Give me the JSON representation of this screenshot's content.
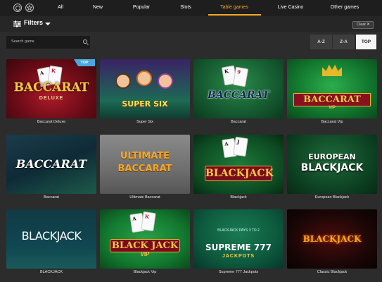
{
  "nav": {
    "tabs": [
      "All",
      "New",
      "Popular",
      "Slots",
      "Table games",
      "Live Casino",
      "Other games"
    ],
    "active_tab": "Table games",
    "icons": [
      "chip-icon",
      "star-icon"
    ]
  },
  "filters": {
    "label": "Filters",
    "clear_label": "Clear",
    "clear_icon": "✕"
  },
  "search": {
    "placeholder": "Search game"
  },
  "sort": {
    "options": [
      "A-Z",
      "Z-A",
      "TOP"
    ],
    "active": "TOP"
  },
  "badge_top": "TOP",
  "games": [
    {
      "name": "Baccarat Deluxe",
      "logo": "BACCARAT",
      "sub": "DELUXE"
    },
    {
      "name": "Super Six",
      "logo": "SUPER SIX"
    },
    {
      "name": "Baccarat",
      "logo": "BACCARAT"
    },
    {
      "name": "Baccarat Vip",
      "logo": "BACCARAT",
      "sub": "VIP"
    },
    {
      "name": "Baccarat",
      "logo": "BACCARAT"
    },
    {
      "name": "Ultimate Baccarat",
      "logo": "ULTIMATE",
      "sub": "BACCARAT"
    },
    {
      "name": "Blackjack",
      "logo": "BLACKJACK"
    },
    {
      "name": "European Blackjack",
      "logo": "EUROPEAN",
      "sub": "BLACKJACK"
    },
    {
      "name": "BLACKJACK",
      "logo": "BLACKJACK"
    },
    {
      "name": "Blackjack Vip",
      "logo": "BLACK JACK",
      "sub": "VIP"
    },
    {
      "name": "Supreme 777 Jackpots",
      "logo": "SUPREME 777",
      "sub": "JACKPOTS",
      "extra": "BLACKJACK PAYS 3 TO 2"
    },
    {
      "name": "Classic Blackjack",
      "logo": "BLACKJACK"
    }
  ],
  "colors": {
    "accent": "#f5a623",
    "background": "#2c2c2c",
    "nav": "#1e1e1e",
    "top_badge": "#4aa8e0"
  }
}
